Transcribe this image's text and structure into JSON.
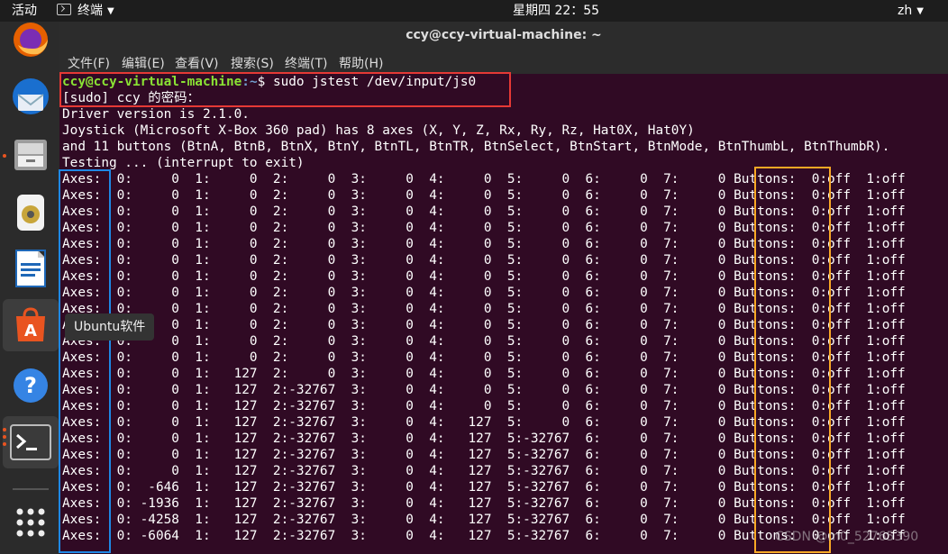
{
  "topbar": {
    "activities": "活动",
    "app_name": "终端",
    "clock": "星期四 22：55",
    "lang": "zh"
  },
  "window": {
    "title": "ccy@ccy-virtual-machine: ~",
    "menus": [
      "文件(F)",
      "编辑(E)",
      "查看(V)",
      "搜索(S)",
      "终端(T)",
      "帮助(H)"
    ]
  },
  "dock": {
    "items": [
      {
        "name": "firefox-icon"
      },
      {
        "name": "thunderbird-icon"
      },
      {
        "name": "files-icon"
      },
      {
        "name": "rhythmbox-icon"
      },
      {
        "name": "libreoffice-writer-icon"
      },
      {
        "name": "ubuntu-software-icon"
      },
      {
        "name": "help-icon"
      },
      {
        "name": "terminal-icon"
      },
      {
        "name": "show-applications-icon"
      }
    ],
    "tooltip": "Ubuntu软件"
  },
  "terminal": {
    "prompt_user": "ccy@ccy-virtual-machine",
    "prompt_path": ":~",
    "prompt_symbol": "$ ",
    "command": "sudo jstest /dev/input/js0",
    "output": [
      "[sudo] ccy 的密码：",
      "Driver version is 2.1.0.",
      "Joystick (Microsoft X-Box 360 pad) has 8 axes (X, Y, Z, Rx, Ry, Rz, Hat0X, Hat0Y)",
      "and 11 buttons (BtnA, BtnB, BtnX, BtnY, BtnTL, BtnTR, BtnSelect, BtnStart, BtnMode, BtnThumbL, BtnThumbR).",
      "Testing ... (interrupt to exit)",
      "Axes:  0:     0  1:     0  2:     0  3:     0  4:     0  5:     0  6:     0  7:     0 Buttons:  0:off  1:off",
      "Axes:  0:     0  1:     0  2:     0  3:     0  4:     0  5:     0  6:     0  7:     0 Buttons:  0:off  1:off",
      "Axes:  0:     0  1:     0  2:     0  3:     0  4:     0  5:     0  6:     0  7:     0 Buttons:  0:off  1:off",
      "Axes:  0:     0  1:     0  2:     0  3:     0  4:     0  5:     0  6:     0  7:     0 Buttons:  0:off  1:off",
      "Axes:  0:     0  1:     0  2:     0  3:     0  4:     0  5:     0  6:     0  7:     0 Buttons:  0:off  1:off",
      "Axes:  0:     0  1:     0  2:     0  3:     0  4:     0  5:     0  6:     0  7:     0 Buttons:  0:off  1:off",
      "Axes:  0:     0  1:     0  2:     0  3:     0  4:     0  5:     0  6:     0  7:     0 Buttons:  0:off  1:off",
      "Axes:  0:     0  1:     0  2:     0  3:     0  4:     0  5:     0  6:     0  7:     0 Buttons:  0:off  1:off",
      "Axes:  0:     0  1:     0  2:     0  3:     0  4:     0  5:     0  6:     0  7:     0 Buttons:  0:off  1:off",
      "Axes:  0:     0  1:     0  2:     0  3:     0  4:     0  5:     0  6:     0  7:     0 Buttons:  0:off  1:off",
      "Axes:  0:     0  1:     0  2:     0  3:     0  4:     0  5:     0  6:     0  7:     0 Buttons:  0:off  1:off",
      "Axes:  0:     0  1:     0  2:     0  3:     0  4:     0  5:     0  6:     0  7:     0 Buttons:  0:off  1:off",
      "Axes:  0:     0  1:   127  2:     0  3:     0  4:     0  5:     0  6:     0  7:     0 Buttons:  0:off  1:off",
      "Axes:  0:     0  1:   127  2:-32767  3:     0  4:     0  5:     0  6:     0  7:     0 Buttons:  0:off  1:off",
      "Axes:  0:     0  1:   127  2:-32767  3:     0  4:     0  5:     0  6:     0  7:     0 Buttons:  0:off  1:off",
      "Axes:  0:     0  1:   127  2:-32767  3:     0  4:   127  5:     0  6:     0  7:     0 Buttons:  0:off  1:off",
      "Axes:  0:     0  1:   127  2:-32767  3:     0  4:   127  5:-32767  6:     0  7:     0 Buttons:  0:off  1:off",
      "Axes:  0:     0  1:   127  2:-32767  3:     0  4:   127  5:-32767  6:     0  7:     0 Buttons:  0:off  1:off",
      "Axes:  0:     0  1:   127  2:-32767  3:     0  4:   127  5:-32767  6:     0  7:     0 Buttons:  0:off  1:off",
      "Axes:  0:  -646  1:   127  2:-32767  3:     0  4:   127  5:-32767  6:     0  7:     0 Buttons:  0:off  1:off",
      "Axes:  0: -1936  1:   127  2:-32767  3:     0  4:   127  5:-32767  6:     0  7:     0 Buttons:  0:off  1:off",
      "Axes:  0: -4258  1:   127  2:-32767  3:     0  4:   127  5:-32767  6:     0  7:     0 Buttons:  0:off  1:off",
      "Axes:  0: -6064  1:   127  2:-32767  3:     0  4:   127  5:-32767  6:     0  7:     0 Buttons:  0:off  1:off"
    ]
  },
  "watermark": "CSDN @m0_52765390",
  "colors": {
    "terminal_bg": "#300a24",
    "prompt_user": "#8ae234",
    "prompt_path": "#729fcf",
    "highlight_command": "#e53935",
    "highlight_axes": "#1e88e5",
    "highlight_buttons": "#f9a825"
  }
}
